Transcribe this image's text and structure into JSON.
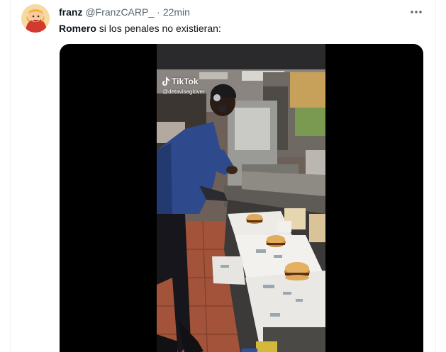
{
  "tweet": {
    "display_name": "franz",
    "handle": "@FranzCARP_",
    "separator": "·",
    "time": "22min",
    "text_bold": "Romero",
    "text_rest": " si los penales no existieran:",
    "more_icon": "more-horizontal-icon"
  },
  "media": {
    "type": "video",
    "watermark_brand": "TikTok",
    "watermark_user": "@detaviseglover"
  },
  "colors": {
    "text_primary": "#0f1419",
    "text_secondary": "#536471",
    "media_background": "#000000",
    "divider": "#eff3f4"
  }
}
